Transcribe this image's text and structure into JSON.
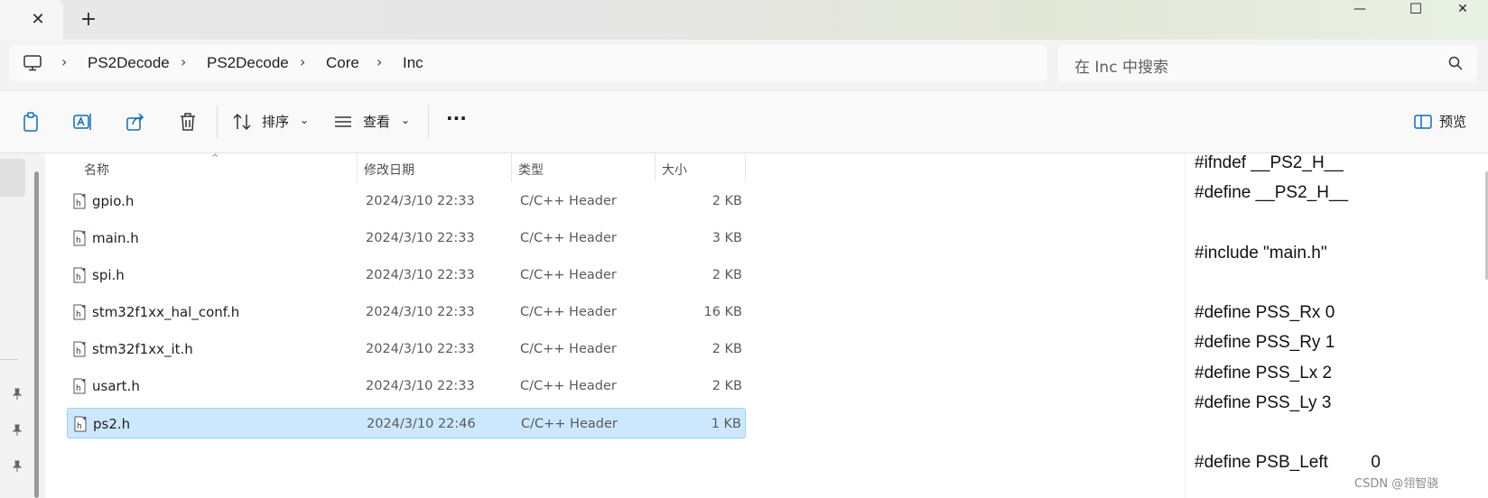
{
  "window": {
    "minimize_glyph": "—",
    "maximize_glyph": "☐",
    "close_glyph": "✕",
    "new_tab_glyph": "+",
    "tab_close_glyph": "✕"
  },
  "address": {
    "separator": "›",
    "crumbs": [
      "PS2Decode",
      "PS2Decode",
      "Core",
      "Inc"
    ]
  },
  "search": {
    "placeholder": "在 Inc 中搜索"
  },
  "toolbar": {
    "sort_label": "排序",
    "view_label": "查看",
    "more_label": "···",
    "preview_label": "预览",
    "dropdown_glyph": "⌄"
  },
  "list": {
    "headers": {
      "name": "名称",
      "date": "修改日期",
      "type": "类型",
      "size": "大小"
    },
    "files": [
      {
        "name": "gpio.h",
        "date": "2024/3/10 22:33",
        "type": "C/C++ Header",
        "size": "2 KB"
      },
      {
        "name": "main.h",
        "date": "2024/3/10 22:33",
        "type": "C/C++ Header",
        "size": "3 KB"
      },
      {
        "name": "spi.h",
        "date": "2024/3/10 22:33",
        "type": "C/C++ Header",
        "size": "2 KB"
      },
      {
        "name": "stm32f1xx_hal_conf.h",
        "date": "2024/3/10 22:33",
        "type": "C/C++ Header",
        "size": "16 KB"
      },
      {
        "name": "stm32f1xx_it.h",
        "date": "2024/3/10 22:33",
        "type": "C/C++ Header",
        "size": "2 KB"
      },
      {
        "name": "usart.h",
        "date": "2024/3/10 22:33",
        "type": "C/C++ Header",
        "size": "2 KB"
      },
      {
        "name": "ps2.h",
        "date": "2024/3/10 22:46",
        "type": "C/C++ Header",
        "size": "1 KB"
      }
    ],
    "selected_file": "ps2.h"
  },
  "preview": {
    "lines": [
      "#ifndef __PS2_H__",
      "#define __PS2_H__",
      "",
      "#include \"main.h\"",
      "",
      "#define PSS_Rx 0",
      "#define PSS_Ry 1",
      "#define PSS_Lx 2",
      "#define PSS_Ly 3",
      "",
      "#define PSB_Left         0"
    ]
  },
  "watermark": "CSDN @翎智骁",
  "colors": {
    "selection_fill": "#cce8ff",
    "selection_border": "#99d1ff",
    "icon_blue": "#0f6cbd"
  }
}
